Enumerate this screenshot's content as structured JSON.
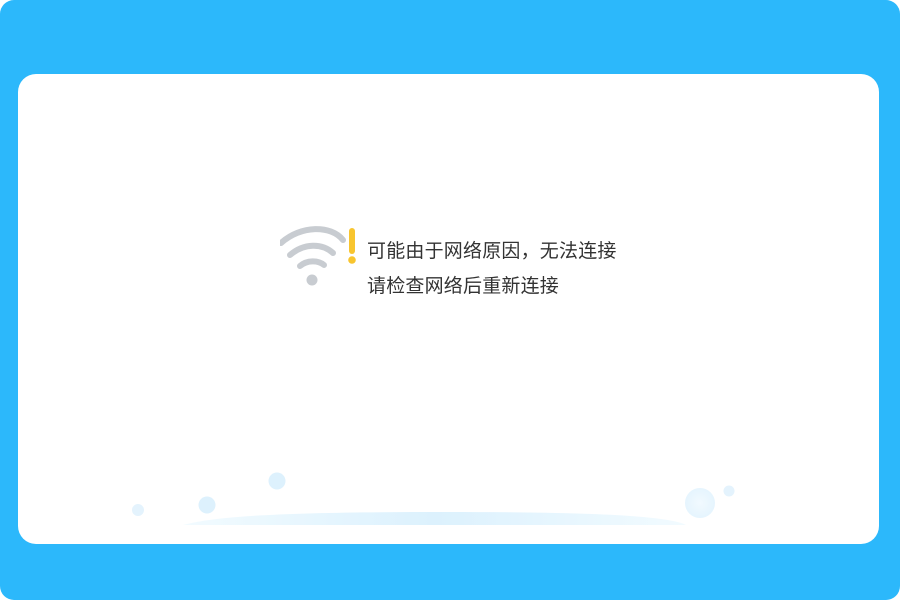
{
  "page": {
    "background_color": "#2cb8fb",
    "panel_color": "#ffffff"
  },
  "error": {
    "icon": "wifi-warning-icon",
    "line1": "可能由于网络原因，无法连接",
    "line2": "请检查网络后重新连接"
  },
  "colors": {
    "wifi_gray": "#c8ccd1",
    "warning_yellow": "#f8c52f",
    "decor_blue": "#dff1fd"
  }
}
